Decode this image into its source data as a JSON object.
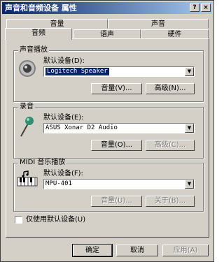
{
  "window": {
    "title": "声音和音频设备 属性",
    "help_glyph": "?",
    "close_glyph": "×"
  },
  "tabs": {
    "back_row": [
      "音量",
      "声音"
    ],
    "front_row": [
      "音频",
      "语声",
      "硬件"
    ]
  },
  "playback": {
    "group_title": "声音播放",
    "default_device_label": "默认设备(D):",
    "device_value": "Logitech Speaker",
    "volume_button": "音量(V)...",
    "advanced_button": "高级(N)..."
  },
  "recording": {
    "group_title": "录音",
    "default_device_label": "默认设备(E):",
    "device_value": "ASUS Xonar D2 Audio",
    "volume_button": "音量(O)...",
    "advanced_button": "高级(C)..."
  },
  "midi": {
    "group_title": "MIDI 音乐播放",
    "default_device_label": "默认设备(F):",
    "device_value": "MPU-401",
    "volume_button": "音量(U)...",
    "about_button": "关于(B)..."
  },
  "options": {
    "only_default_label": "仅使用默认设备(U)"
  },
  "footer": {
    "ok": "确定",
    "cancel": "取消",
    "apply": "应用(A)"
  },
  "colors": {
    "face": "#d4d0c8",
    "title_start": "#0a246a",
    "title_end": "#a6caf0",
    "selection": "#0a246a"
  },
  "icons": {
    "playback": "speaker-icon",
    "recording": "microphone-icon",
    "midi": "midi-keyboard-icon",
    "dropdown": "chevron-down-icon"
  }
}
